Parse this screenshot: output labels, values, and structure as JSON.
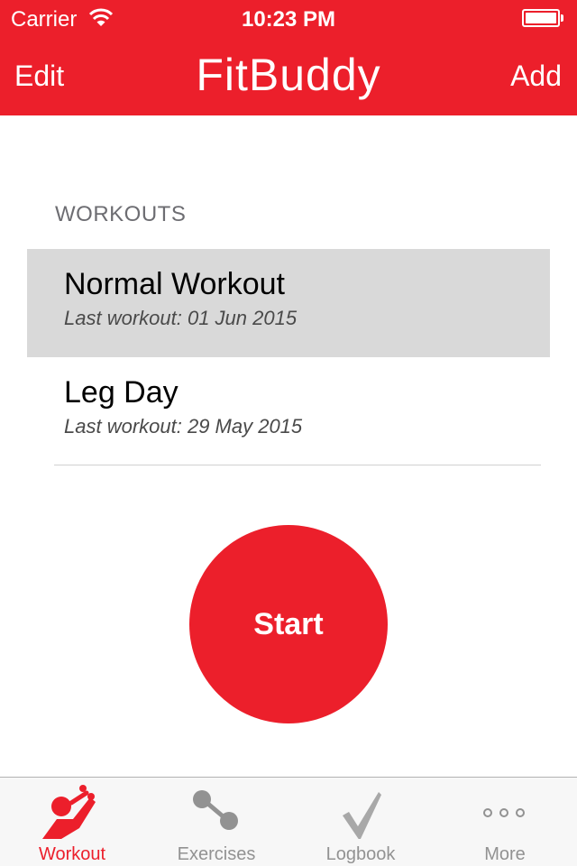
{
  "status_bar": {
    "carrier": "Carrier",
    "time": "10:23 PM"
  },
  "nav": {
    "edit_label": "Edit",
    "title": "FitBuddy",
    "add_label": "Add"
  },
  "workouts": {
    "section_title": "WORKOUTS",
    "items": [
      {
        "name": "Normal Workout",
        "last_workout": "Last workout:  01 Jun 2015",
        "selected": true
      },
      {
        "name": "Leg Day",
        "last_workout": "Last workout:  29 May 2015",
        "selected": false
      }
    ]
  },
  "start_button": {
    "label": "Start"
  },
  "tabs": [
    {
      "label": "Workout",
      "icon": "workout-person-icon",
      "active": true
    },
    {
      "label": "Exercises",
      "icon": "dumbbell-icon",
      "active": false
    },
    {
      "label": "Logbook",
      "icon": "checkmark-icon",
      "active": false
    },
    {
      "label": "More",
      "icon": "more-dots-icon",
      "active": false
    }
  ],
  "colors": {
    "accent": "#ec1f2b",
    "inactive": "#929292",
    "selected_row": "#d9d9d9"
  }
}
